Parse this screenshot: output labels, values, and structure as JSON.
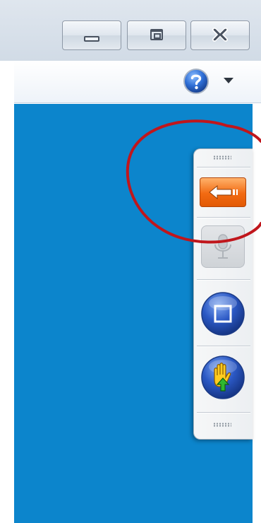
{
  "window": {
    "controls": [
      {
        "name": "minimize-button",
        "icon": "minimize-icon"
      },
      {
        "name": "maximize-button",
        "icon": "maximize-icon"
      },
      {
        "name": "close-button",
        "icon": "close-icon"
      }
    ]
  },
  "toolbar": {
    "help_icon": "help-icon",
    "help_menu_icon": "chevron-down-icon"
  },
  "panel": {
    "tools": [
      {
        "name": "back-arrow-button",
        "icon": "back-arrow-icon",
        "state": "active"
      },
      {
        "name": "microphone-button",
        "icon": "microphone-icon",
        "state": "disabled"
      },
      {
        "name": "stop-button",
        "icon": "stop-icon",
        "state": "enabled"
      },
      {
        "name": "raise-hand-button",
        "icon": "raise-hand-icon",
        "state": "enabled"
      }
    ]
  },
  "colors": {
    "content_background": "#0c85cc",
    "annotation_circle": "#c0161c",
    "active_tool": "#f26a12"
  }
}
